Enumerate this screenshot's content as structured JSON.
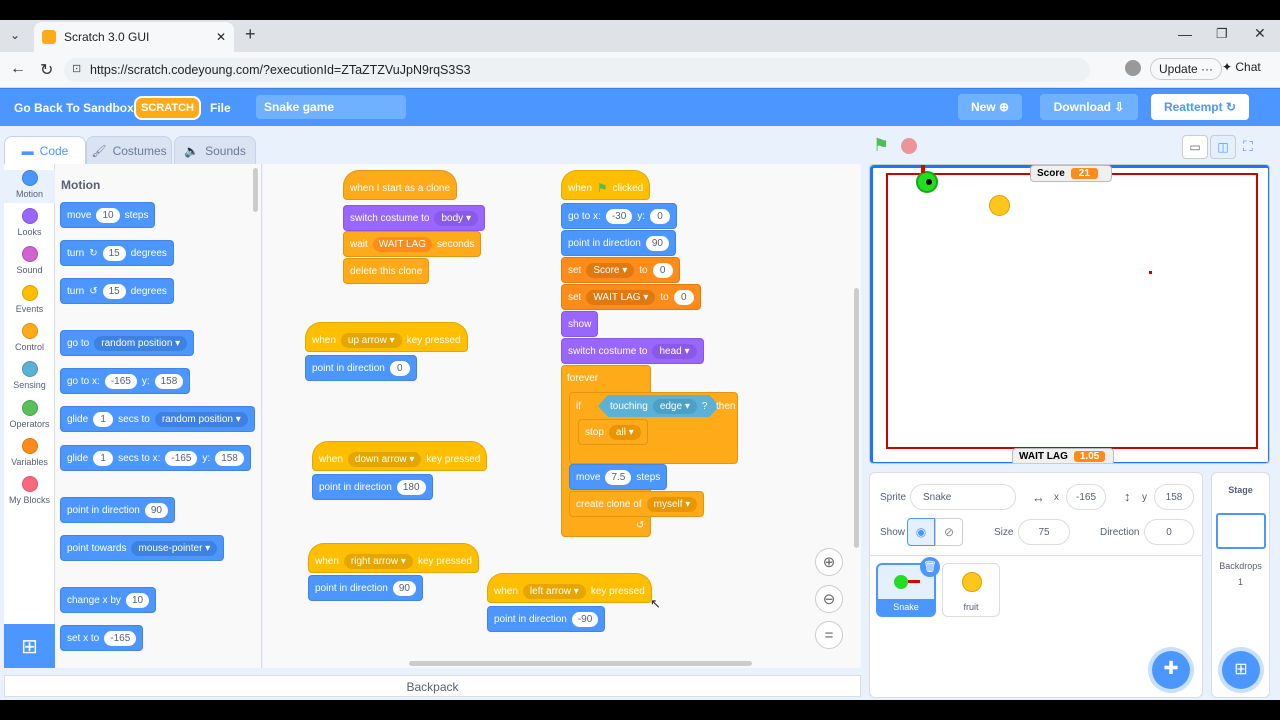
{
  "browser": {
    "tab_title": "Scratch 3.0 GUI",
    "url": "https://scratch.codeyoung.com/?executionId=ZTaZTZVuJpN9rqS3S3",
    "update_label": "Update",
    "chat_label": "Chat"
  },
  "menu": {
    "back_label": "Go Back To Sandbox",
    "logo": "SCRATCH",
    "file_label": "File",
    "project_name": "Snake game",
    "new_label": "New",
    "download_label": "Download",
    "reattempt_label": "Reattempt"
  },
  "tabs": {
    "code": "Code",
    "costumes": "Costumes",
    "sounds": "Sounds"
  },
  "categories": [
    {
      "label": "Motion",
      "color": "#4c97ff"
    },
    {
      "label": "Looks",
      "color": "#9966ff"
    },
    {
      "label": "Sound",
      "color": "#cf63cf"
    },
    {
      "label": "Events",
      "color": "#ffbf00"
    },
    {
      "label": "Control",
      "color": "#ffab19"
    },
    {
      "label": "Sensing",
      "color": "#5cb1d6"
    },
    {
      "label": "Operators",
      "color": "#59c059"
    },
    {
      "label": "Variables",
      "color": "#ff8c1a"
    },
    {
      "label": "My Blocks",
      "color": "#ff6680"
    }
  ],
  "palette": {
    "title": "Motion",
    "move": [
      "move",
      "10",
      "steps"
    ],
    "turn_right": [
      "turn",
      "15",
      "degrees"
    ],
    "turn_left": [
      "turn",
      "15",
      "degrees"
    ],
    "goto": [
      "go to",
      "random position"
    ],
    "gotoxy": [
      "go to x:",
      "-165",
      "y:",
      "158"
    ],
    "glide1": [
      "glide",
      "1",
      "secs to",
      "random position"
    ],
    "glide2": [
      "glide",
      "1",
      "secs to x:",
      "-165",
      "y:",
      "158"
    ],
    "pointdir": [
      "point in direction",
      "90"
    ],
    "pointtowards": [
      "point towards",
      "mouse-pointer"
    ],
    "changex": [
      "change x by",
      "10"
    ],
    "setx": [
      "set x to",
      "-165"
    ]
  },
  "scripts": {
    "clone": {
      "hat": "when I start as a clone",
      "costume": "switch costume to",
      "costume_val": "body",
      "wait": "wait",
      "wait_val": "WAIT LAG",
      "seconds": "seconds",
      "delete": "delete this clone"
    },
    "up": {
      "when": "when",
      "key": "up arrow",
      "pressed": "key pressed",
      "point": "point in direction",
      "val": "0"
    },
    "down": {
      "when": "when",
      "key": "down arrow",
      "pressed": "key pressed",
      "point": "point in direction",
      "val": "180"
    },
    "right": {
      "when": "when",
      "key": "right arrow",
      "pressed": "key pressed",
      "point": "point in direction",
      "val": "90"
    },
    "left": {
      "when": "when",
      "key": "left arrow",
      "pressed": "key pressed",
      "point": "point in direction",
      "val": "-90"
    },
    "main": {
      "when": "when",
      "clicked": "clicked",
      "gotox": "go to x:",
      "x": "-30",
      "y_lbl": "y:",
      "y": "0",
      "point": "point in direction",
      "dir": "90",
      "set": "set",
      "var1": "Score",
      "to": "to",
      "val1": "0",
      "var2": "WAIT LAG",
      "val2": "0",
      "show": "show",
      "costume": "switch costume to",
      "costume_val": "head",
      "forever": "forever",
      "if": "if",
      "touching": "touching",
      "edge": "edge",
      "q": "?",
      "then": "then",
      "stop": "stop",
      "stop_val": "all",
      "move": "move",
      "move_val": "7.5",
      "steps": "steps",
      "clone": "create clone of",
      "clone_val": "myself"
    }
  },
  "backpack": "Backpack",
  "stage": {
    "score_label": "Score",
    "score_value": "21",
    "waitlag_label": "WAIT LAG",
    "waitlag_value": "1.05"
  },
  "sprite_info": {
    "sprite_lbl": "Sprite",
    "sprite_name": "Snake",
    "x_lbl": "x",
    "x": "-165",
    "y_lbl": "y",
    "y": "158",
    "show_lbl": "Show",
    "size_lbl": "Size",
    "size": "75",
    "direction_lbl": "Direction",
    "direction": "0"
  },
  "sprites": [
    {
      "name": "Snake"
    },
    {
      "name": "fruit"
    }
  ],
  "stage_pane": {
    "title": "Stage",
    "backdrops_lbl": "Backdrops",
    "backdrops": "1"
  }
}
